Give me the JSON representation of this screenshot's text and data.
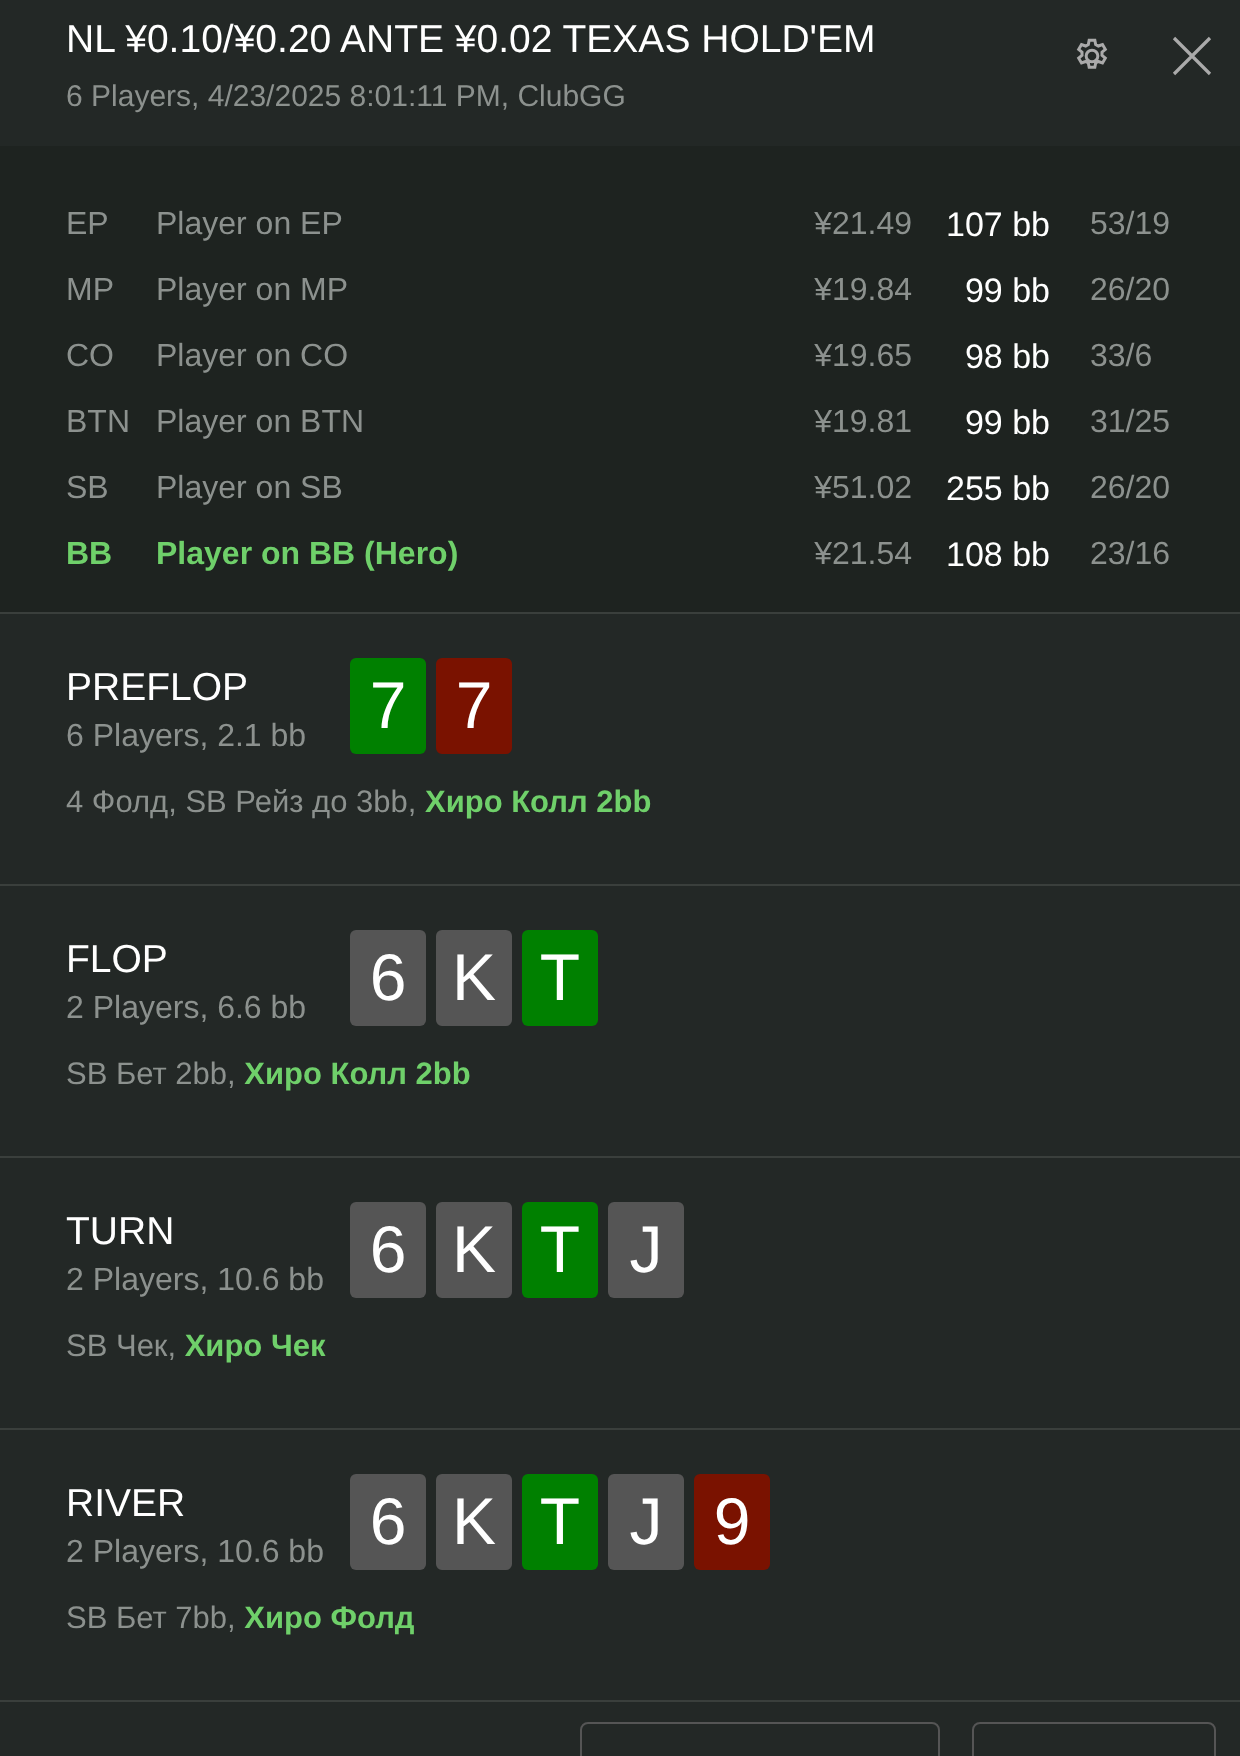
{
  "header": {
    "title": "NL ¥0.10/¥0.20 ANTE ¥0.02 TEXAS HOLD'EM",
    "subtitle": "6 Players, 4/23/2025 8:01:11 PM, ClubGG"
  },
  "players": [
    {
      "position": "EP",
      "name": "Player on EP",
      "stack": "¥21.49",
      "bb": "107 bb",
      "stats": "53/19",
      "hero": false
    },
    {
      "position": "MP",
      "name": "Player on MP",
      "stack": "¥19.84",
      "bb": "99 bb",
      "stats": "26/20",
      "hero": false
    },
    {
      "position": "CO",
      "name": "Player on CO",
      "stack": "¥19.65",
      "bb": "98 bb",
      "stats": "33/6",
      "hero": false
    },
    {
      "position": "BTN",
      "name": "Player on BTN",
      "stack": "¥19.81",
      "bb": "99 bb",
      "stats": "31/25",
      "hero": false
    },
    {
      "position": "SB",
      "name": "Player on SB",
      "stack": "¥51.02",
      "bb": "255 bb",
      "stats": "26/20",
      "hero": false
    },
    {
      "position": "BB",
      "name": "Player on BB (Hero)",
      "stack": "¥21.54",
      "bb": "108 bb",
      "stats": "23/16",
      "hero": true
    }
  ],
  "streets": [
    {
      "name": "PREFLOP",
      "info": "6 Players, 2.1 bb",
      "cards": [
        {
          "rank": "7",
          "color": "#008000"
        },
        {
          "rank": "7",
          "color": "#7a1200"
        }
      ],
      "actions": [
        {
          "text": "4 Фолд, SB Рейз до 3bb,",
          "hero": false
        },
        {
          "text": "Хиро Колл 2bb",
          "hero": true
        }
      ]
    },
    {
      "name": "FLOP",
      "info": "2 Players, 6.6 bb",
      "cards": [
        {
          "rank": "6",
          "color": "#555555"
        },
        {
          "rank": "K",
          "color": "#555555"
        },
        {
          "rank": "T",
          "color": "#008000"
        }
      ],
      "actions": [
        {
          "text": "SB Бет 2bb,",
          "hero": false
        },
        {
          "text": "Хиро Колл 2bb",
          "hero": true
        }
      ]
    },
    {
      "name": "TURN",
      "info": "2 Players, 10.6 bb",
      "cards": [
        {
          "rank": "6",
          "color": "#555555"
        },
        {
          "rank": "K",
          "color": "#555555"
        },
        {
          "rank": "T",
          "color": "#008000"
        },
        {
          "rank": "J",
          "color": "#555555"
        }
      ],
      "actions": [
        {
          "text": "SB Чек,",
          "hero": false
        },
        {
          "text": "Хиро Чек",
          "hero": true
        }
      ]
    },
    {
      "name": "RIVER",
      "info": "2 Players, 10.6 bb",
      "cards": [
        {
          "rank": "6",
          "color": "#555555"
        },
        {
          "rank": "K",
          "color": "#555555"
        },
        {
          "rank": "T",
          "color": "#008000"
        },
        {
          "rank": "J",
          "color": "#555555"
        },
        {
          "rank": "9",
          "color": "#7a1200"
        }
      ],
      "actions": [
        {
          "text": "SB Бет 7bb,",
          "hero": false
        },
        {
          "text": "Хиро Фолд",
          "hero": true
        }
      ]
    }
  ]
}
